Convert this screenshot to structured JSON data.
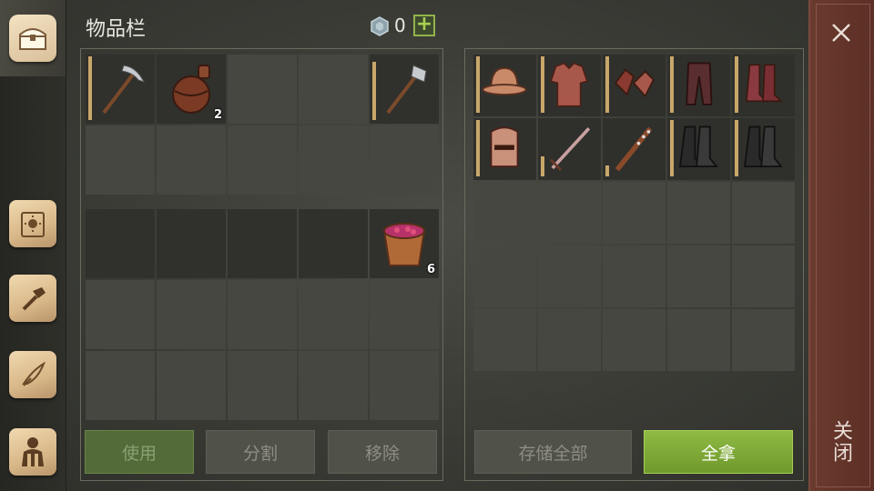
{
  "header": {
    "title": "物品栏",
    "coin_count": "0",
    "add_label": "+"
  },
  "sidebar": {
    "items": [
      {
        "name": "chest-icon",
        "active": true
      },
      {
        "name": "sun-book-icon"
      },
      {
        "name": "hammer-map-icon"
      },
      {
        "name": "quill-scroll-icon"
      },
      {
        "name": "character-icon"
      }
    ]
  },
  "inventory": {
    "slots": [
      {
        "item": "pickaxe-icon",
        "durability": 0.95
      },
      {
        "item": "flask-icon",
        "qty": "2"
      },
      {},
      {},
      {
        "item": "hatchet-icon",
        "durability": 0.85
      },
      {},
      {},
      {},
      {},
      {}
    ],
    "lower_slots": [
      {},
      {},
      {},
      {},
      {
        "item": "berry-basket-icon",
        "qty": "6"
      },
      {},
      {},
      {},
      {},
      {},
      {},
      {},
      {},
      {},
      {}
    ],
    "buttons": {
      "use": "使用",
      "split": "分割",
      "remove": "移除"
    }
  },
  "container": {
    "slots": [
      {
        "item": "kettle-helmet-icon",
        "durability": 0.95
      },
      {
        "item": "chainmail-icon",
        "durability": 0.95
      },
      {
        "item": "chainmail-gloves-icon",
        "durability": 0.95
      },
      {
        "item": "leather-pants-icon",
        "durability": 0.95
      },
      {
        "item": "red-boots-icon",
        "durability": 0.95
      },
      {
        "item": "great-helm-icon",
        "durability": 0.95
      },
      {
        "item": "sword-icon",
        "durability": 0.35
      },
      {
        "item": "spiked-club-icon",
        "durability": 0.2
      },
      {
        "item": "dark-boots-icon",
        "durability": 0.95
      },
      {
        "item": "dark-boots-icon",
        "durability": 0.95
      }
    ],
    "buttons": {
      "store_all": "存储全部",
      "take_all": "全拿"
    }
  },
  "close": {
    "label": "关闭"
  },
  "colors": {
    "accent_green": "#8fba44",
    "close_bar": "#6b3a2e",
    "durability": "#c9a76b"
  }
}
